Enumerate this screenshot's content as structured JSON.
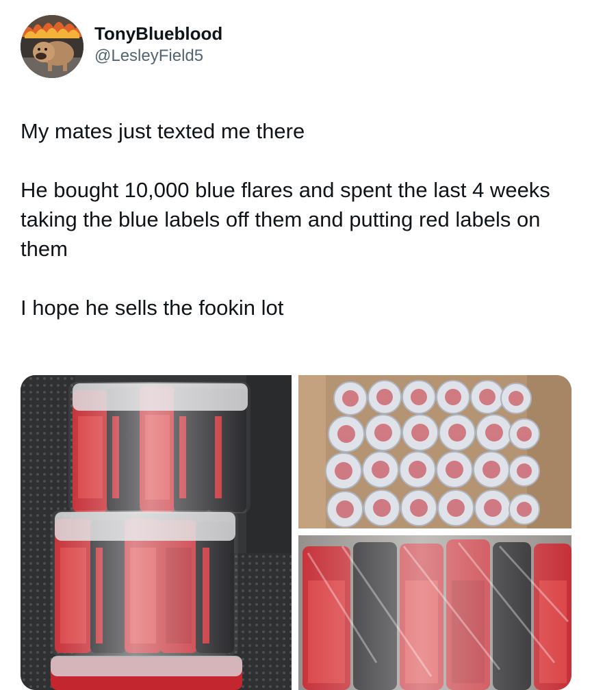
{
  "post": {
    "author": {
      "display_name": "TonyBlueblood",
      "handle": "@LesleyField5",
      "avatar_icon": "bulldog-avatar-icon"
    },
    "paragraphs": [
      "My mates just texted me there",
      "He bought 10,000 blue flares and spent the last 4 weeks taking the blue labels off them and putting red labels on them",
      "I hope he sells the fookin lot"
    ],
    "media": {
      "count": 3,
      "images": [
        {
          "subject": "photo-red-flares-on-car-seat"
        },
        {
          "subject": "photo-box-of-wrapped-flares"
        },
        {
          "subject": "photo-flares-closeup"
        }
      ]
    }
  },
  "colors": {
    "text_primary": "#0f1419",
    "text_secondary": "#536471",
    "flare_red": "#c3262e",
    "flare_black": "#1d1d21"
  }
}
